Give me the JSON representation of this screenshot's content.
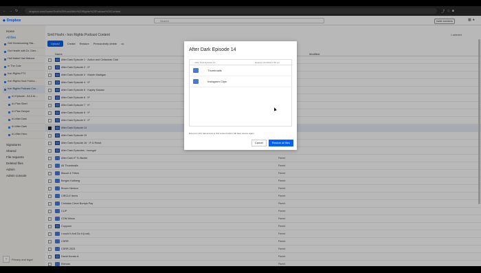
{
  "browser": {
    "url": "dropbox.com/home/Smll%20Hoshi/Win%20Rights%20Podcast%20Content",
    "nav_icons": [
      "back-arrow-icon",
      "forward-arrow-icon",
      "reload-icon"
    ]
  },
  "header": {
    "logo": "Dropbox",
    "search_placeholder": "Search",
    "invite_label": "Invite members"
  },
  "sidebar": {
    "home": "Home",
    "all_files": "All files",
    "tree": [
      "Grill Homecoming Sta…",
      "Gut Health with Dr. Glen…",
      "Hall Mabel Hair Maloca",
      "In The Cole",
      "Iron Rights PT1",
      "Iron Rights Hoot Forma…",
      "Iron Rights Podcast Con…",
      "#1 Episode - Ali & Ar…",
      "#1 Plan Steel",
      "#1 Plan Deeper",
      "#1 After Dark",
      "#1 After Dark",
      "#1 After Hero"
    ],
    "links": [
      "Signatures",
      "Shared",
      "File requests",
      "Deleted files",
      "Admin",
      "Admin console"
    ],
    "bottom_label": "Privacy and legal"
  },
  "main": {
    "breadcrumb": "Smll Hoshi › Iron Rights Podcast Content",
    "toolbar": {
      "upload": "Upload",
      "create": "Create",
      "restore": "Restore",
      "delete": "Permanently delete"
    },
    "selected_count": "1 selected",
    "columns": {
      "name": "Name",
      "modified": "Modified"
    },
    "rows": [
      {
        "name": "After Dark Episode 1 · Action and Cellaneas Club",
        "icon": "shared",
        "meta": ""
      },
      {
        "name": "After Dark Episode 2 · IF",
        "icon": "shared",
        "meta": ""
      },
      {
        "name": "After Dark Episode 3 · Maxim Madigan",
        "icon": "shared",
        "meta": ""
      },
      {
        "name": "After Dark Episode 4 · IF",
        "icon": "shared",
        "meta": ""
      },
      {
        "name": "After Dark Episode 5 · Kayley Kazaar",
        "icon": "shared",
        "meta": ""
      },
      {
        "name": "After Dark Episode 6 · IF",
        "icon": "shared",
        "meta": ""
      },
      {
        "name": "After Dark Episode 7 · IF",
        "icon": "shared",
        "meta": ""
      },
      {
        "name": "After Dark Episode 8 · IF",
        "icon": "shared",
        "meta": ""
      },
      {
        "name": "After Dark Episode 9 · IF",
        "icon": "shared",
        "meta": ""
      },
      {
        "name": "After Dark Episode 14",
        "icon": "shared",
        "meta": "",
        "selected": true
      },
      {
        "name": "After Dark Episode 15",
        "icon": "shared",
        "meta": ""
      },
      {
        "name": "After Dark Episode 16 · IF & React",
        "icon": "shared",
        "meta": ""
      },
      {
        "name": "After Dark Episodes - Isumgat",
        "icon": "shared",
        "meta": ""
      },
      {
        "name": "After Dark IF To Baxter",
        "icon": "folder",
        "meta": "Parent"
      },
      {
        "name": "All Thumbnails",
        "icon": "folder",
        "meta": "Parent"
      },
      {
        "name": "Biscuit & Tribes",
        "icon": "folder",
        "meta": "Parent"
      },
      {
        "name": "Bergen Kallberg",
        "icon": "folder",
        "meta": "Parent"
      },
      {
        "name": "Brown Hanson",
        "icon": "folder",
        "meta": "Parent"
      },
      {
        "name": "CIRCLE Items",
        "icon": "folder",
        "meta": "Parent"
      },
      {
        "name": "Christian Cleve Bumps Pay",
        "icon": "folder",
        "meta": "Parent"
      },
      {
        "name": "CLIP",
        "icon": "folder",
        "meta": "Parent"
      },
      {
        "name": "COM Minus",
        "icon": "folder",
        "meta": "Parent"
      },
      {
        "name": "Copyone",
        "icon": "shared",
        "meta": "Parent"
      },
      {
        "name": "I could It And Do it (Lost)",
        "icon": "folder",
        "meta": "Parent"
      },
      {
        "name": "CSRR",
        "icon": "folder",
        "meta": "Parent"
      },
      {
        "name": "CSRR 2023",
        "icon": "folder",
        "meta": "Parent"
      },
      {
        "name": "David Koosis A",
        "icon": "shared",
        "meta": "Parent"
      },
      {
        "name": "Eldrodo",
        "icon": "folder",
        "meta": "Parent"
      }
    ]
  },
  "modal": {
    "title": "After Dark Episode 14",
    "path_col": "…/After Dark Episode 14",
    "date_col": "Deleted 11/1/2023 2:55 pm",
    "items": [
      {
        "name": "Thumbnails",
        "icon": "folder-icon"
      },
      {
        "name": "Instagram Clips",
        "icon": "folder-icon"
      }
    ],
    "note": "Everyone who had access to this content before will have access again.",
    "cancel": "Cancel",
    "restore_all": "Restore all files"
  },
  "colors": {
    "accent": "#0061fe",
    "folder": "#4a7bd3"
  }
}
